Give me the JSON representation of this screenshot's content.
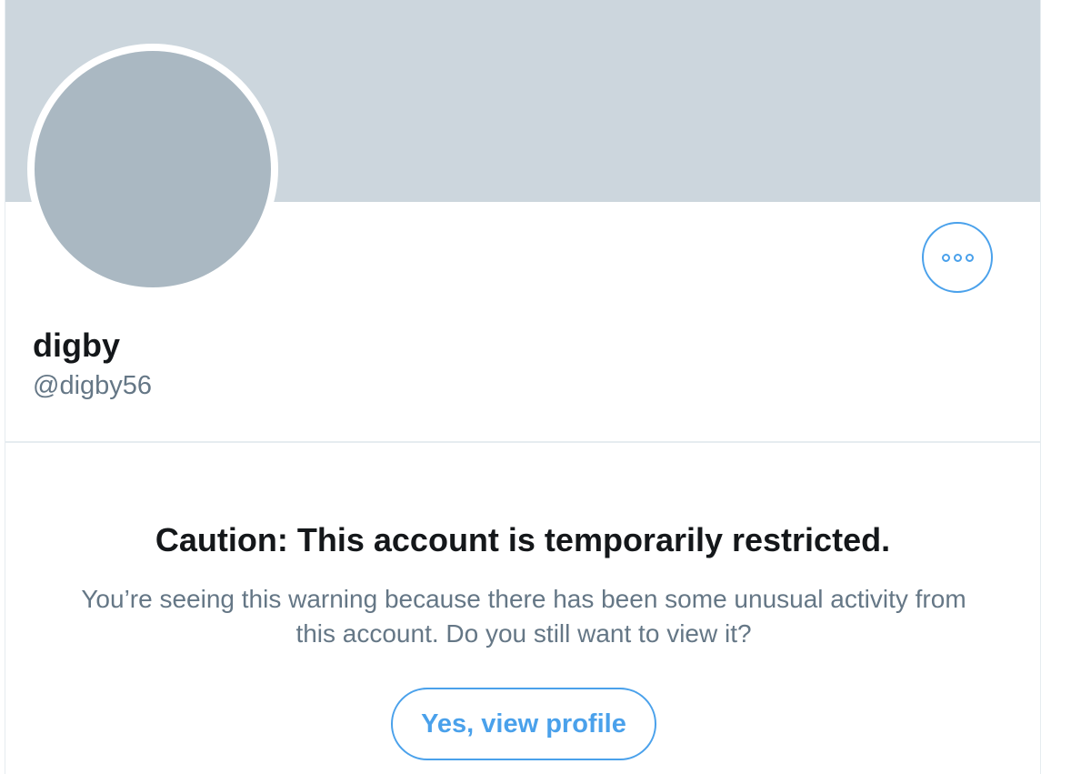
{
  "profile": {
    "display_name": "digby",
    "handle": "@digby56",
    "more_button_icon": "more-options-icon"
  },
  "warning": {
    "title": "Caution: This account is temporarily restricted.",
    "message_line1": "You’re seeing this warning because there has been some unusual activity from",
    "message_line2": "this account. Do you still want to view it?",
    "button_label": "Yes, view profile"
  },
  "colors": {
    "banner": "#ccd6dd",
    "avatar": "#aab8c2",
    "accent": "#4aa1eb",
    "primary_text": "#14171a",
    "secondary_text": "#657786"
  }
}
